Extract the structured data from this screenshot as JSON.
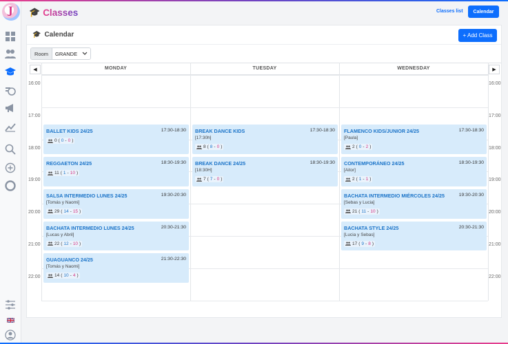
{
  "header": {
    "title": "Classes",
    "classes_list_link": "Classes list",
    "calendar_button": "Calendar"
  },
  "card": {
    "title": "Calendar",
    "add_class_button": "+ Add Class",
    "room_label": "Room",
    "room_value": "GRANDE"
  },
  "days": [
    "MONDAY",
    "TUESDAY",
    "WEDNESDAY"
  ],
  "times": [
    "16:00",
    "17:00",
    "18:00",
    "19:00",
    "20:00",
    "21:00",
    "22:00"
  ],
  "events": {
    "mon": [
      {
        "name": "BALLET KIDS 24/25",
        "time": "17:30-18:30",
        "teacher": "",
        "total": "0",
        "a": "0",
        "b": "0"
      },
      {
        "name": "REGGAETON 24/25",
        "time": "18:30-19:30",
        "teacher": "",
        "total": "11",
        "a": "1",
        "b": "10"
      },
      {
        "name": "SALSA INTERMEDIO LUNES 24/25",
        "time": "19:30-20:30",
        "teacher": "[Tomás y Naomi]",
        "total": "29",
        "a": "14",
        "b": "15"
      },
      {
        "name": "BACHATA INTERMEDIO LUNES 24/25",
        "time": "20:30-21:30",
        "teacher": "[Lucas y Abril]",
        "total": "22",
        "a": "12",
        "b": "10"
      },
      {
        "name": "GUAGUANCO 24/25",
        "time": "21:30-22:30",
        "teacher": "[Tomás y Naomi]",
        "total": "14",
        "a": "10",
        "b": "4"
      }
    ],
    "tue": [
      {
        "name": "BREAK DANCE KIDS",
        "time": "17:30-18:30",
        "teacher": "[17:30h]",
        "total": "8",
        "a": "8",
        "b": "0"
      },
      {
        "name": "BREAK DANCE 24/25",
        "time": "18:30-19:30",
        "teacher": "[18:30H]",
        "total": "7",
        "a": "7",
        "b": "0"
      }
    ],
    "wed": [
      {
        "name": "FLAMENCO KIDS/JUNIOR 24/25",
        "time": "17:30-18:30",
        "teacher": "[Paula]",
        "total": "2",
        "a": "0",
        "b": "2"
      },
      {
        "name": "CONTEMPORÁNEO 24/25",
        "time": "18:30-19:30",
        "teacher": "[Aitor]",
        "total": "2",
        "a": "1",
        "b": "1"
      },
      {
        "name": "BACHATA INTERMEDIO MIÉRCOLES 24/25",
        "time": "19:30-20:30",
        "teacher": "[Sebas y Lucia]",
        "total": "21",
        "a": "11",
        "b": "10"
      },
      {
        "name": "BACHATA STYLE 24/25",
        "time": "20:30-21:30",
        "teacher": "[Lucia y Sebas]",
        "total": "17",
        "a": "9",
        "b": "8"
      }
    ]
  }
}
